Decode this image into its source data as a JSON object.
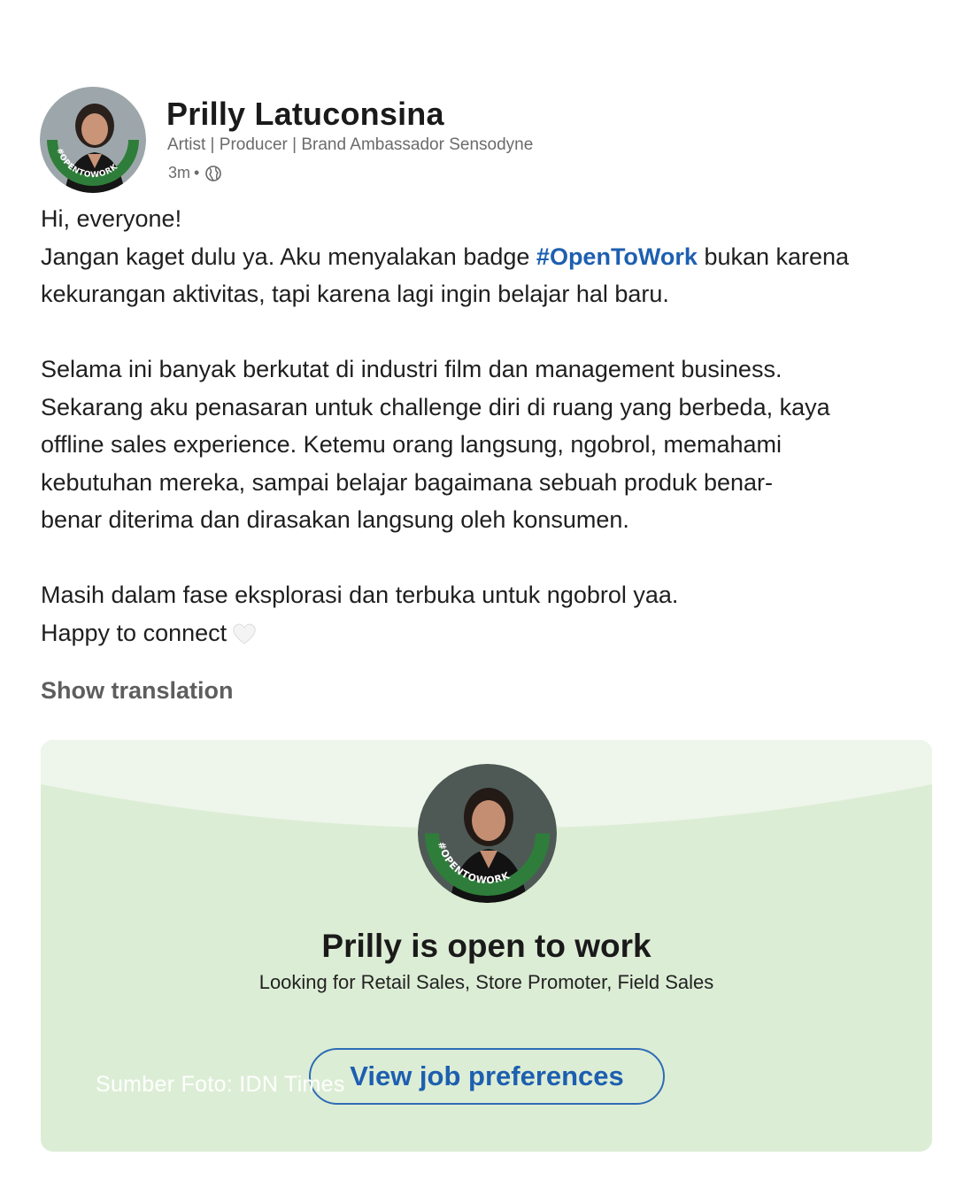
{
  "author": {
    "name": "Prilly Latuconsina",
    "headline": "Artist | Producer | Brand Ambassador Sensodyne",
    "time": "3m",
    "separator": "•",
    "visibility_icon": "globe-icon",
    "avatar_badge": "#OPENTOWORK"
  },
  "post": {
    "greeting": "Hi, everyone!",
    "p1_before": "Jangan kaget dulu ya. Aku menyalakan badge ",
    "hashtag": "#OpenToWork",
    "p1_after": " bukan karena kekurangan aktivitas, tapi karena lagi ingin belajar hal baru.",
    "p2_line1": "Selama ini banyak berkutat di industri film dan management business.",
    "p2_line2": "Sekarang aku penasaran untuk challenge diri di ruang yang berbeda, kaya",
    "p2_line3": "offline sales experience. Ketemu orang langsung, ngobrol, memahami",
    "p2_line4": "kebutuhan mereka, sampai belajar bagaimana sebuah produk benar-",
    "p2_line5": "benar diterima dan dirasakan langsung oleh konsumen.",
    "p3_line1": "Masih dalam fase eksplorasi dan terbuka untuk ngobrol yaa.",
    "p3_line2": "Happy to connect",
    "heart_icon": "white-heart-icon",
    "show_translation": "Show translation"
  },
  "open_to_work": {
    "avatar_badge": "#OPENTOWORK",
    "title": "Prilly is open to work",
    "subtitle": "Looking for Retail Sales, Store Promoter, Field Sales",
    "button_label": "View job preferences"
  },
  "watermark": "Sumber Foto: IDN Times",
  "colors": {
    "accent_blue": "#1d5fb0",
    "card_green": "#dcedd5",
    "card_light": "#eef5ea",
    "badge_green": "#2f7d3a"
  }
}
